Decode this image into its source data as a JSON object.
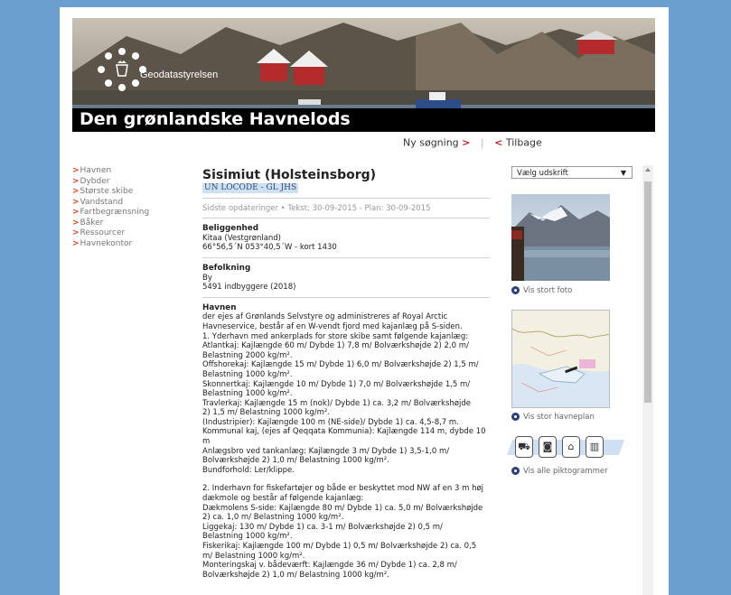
{
  "banner": {
    "logo_text": "Geodatastyrelsen",
    "title": "Den grønlandske Havnelods"
  },
  "toplinks": {
    "new_search": "Ny søgning",
    "new_search_arrow": ">",
    "separator": "|",
    "back_arrow": "<",
    "back": "Tilbage"
  },
  "nav": {
    "arrow": ">",
    "items": [
      "Havnen",
      "Dybder",
      "Største skibe",
      "Vandstand",
      "Fartbegrænsning",
      "Båker",
      "Ressourcer",
      "Havnekontor"
    ]
  },
  "main": {
    "title": "Sisimiut (Holsteinsborg)",
    "locode": "UN LOCODE - GL JHS",
    "updates": "Sidste opdateringer • Tekst: 30-09-2015 - Plan: 30-09-2015",
    "location_title": "Beliggenhed",
    "location_line1": "Kitaa (Vestgrønland)",
    "location_line2": "66°56,5´N 053°40,5´W - kort 1430",
    "population_title": "Befolkning",
    "population_line1": "By",
    "population_line2": "5491 indbyggere (2018)",
    "harbour_title": "Havnen",
    "harbour_text": "der ejes af Grønlands Selvstyre og administreres af Royal Arctic\nHavneservice, består af en W-vendt fjord med kajanlæg på S-siden.\n1. Yderhavn med ankerplads for store skibe samt følgende kajanlæg:\nAtlantkaj: Kajlængde 60 m/ Dybde 1) 7,8 m/ Bolværkshøjde 2) 2,0 m/\nBelastning 2000 kg/m².\nOffshorekaj: Kajlængde 15 m/ Dybde 1) 6,0 m/ Bolværkshøjde 2) 1,5 m/\nBelastning 1000 kg/m².\nSkonnertkaj: Kajlængde 10 m/ Dybde 1) 7,0 m/ Bolværkshøjde 1,5 m/\nBelastning 1000 kg/m².\nTravlerkaj: Kajlængde 15 m (nok)/ Dybde 1) ca. 3,2 m/ Bolværkshøjde\n2) 1,5 m/ Belastning 1000 kg/m².\n(Industripier): Kajlængde 100 m (NE-side)/ Dybde 1) ca. 4,5-8,7 m.\nKommunal kaj, (ejes af Qeqqata Kommunia): Kajlængde 114 m, dybde 10\nm\nAnlægsbro ved tankanlæg: Kajlængde 3 m/ Dybde 1) 3,5-1,0 m/\nBolværkshøjde 2) 1,0 m/ Belastning 1000 kg/m².\nBundforhold: Ler/klippe.",
    "harbour_text2": "2. Inderhavn for fiskefartøjer og både er beskyttet mod NW af en 3 m høj\ndækmole og består af følgende kajanlæg:\nDækmolens S-side: Kajlængde 80 m/ Dybde 1) ca. 5,0 m/ Bolværkshøjde\n2) ca. 1,0 m/ Belastning 1000 kg/m².\nLiggekaj: 130 m/ Dybde 1) ca. 3-1 m/ Bolværkshøjde 2) 0,5 m/\nBelastning 1000 kg/m².\nFiskerikaj: Kajlængde 100 m/ Dybde 1) 0,5 m/ Bolværkshøjde 2) ca. 0,5\nm/ Belastning 1000 kg/m².\nMonteringskaj v. bådeværft: Kajlængde 36 m/ Dybde 1) ca. 2,8 m/\nBolværkshøjde 2) 1,0 m/ Belastning 1000 kg/m²."
  },
  "right": {
    "select_value": "Vælg udskrift",
    "select_caret": "▼",
    "photo_link": "Vis stort foto",
    "map_link": "Vis stor havneplan",
    "picto_link": "Vis alle piktogrammer"
  },
  "colors": {
    "background": "#6b9fd0",
    "accent_red": "#c0202a",
    "nav_arrow": "#d9431e",
    "locode_highlight": "#cfe0f0"
  }
}
